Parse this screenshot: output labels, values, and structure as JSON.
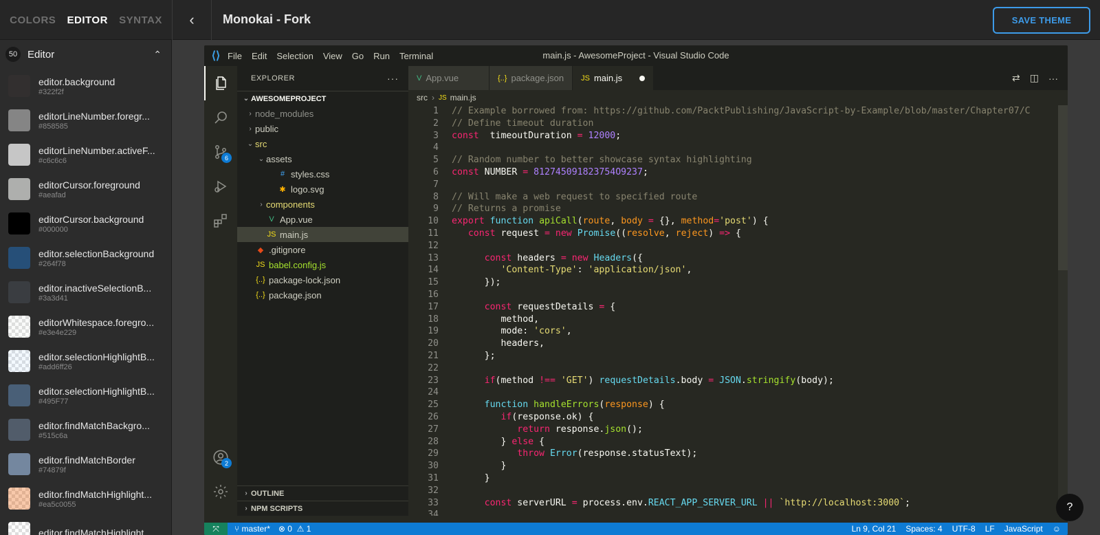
{
  "topbar": {
    "tabs": [
      "COLORS",
      "EDITOR",
      "SYNTAX"
    ],
    "active_tab": "EDITOR",
    "theme_name": "Monokai - Fork",
    "save_label": "SAVE THEME",
    "accent": "#3d9be9"
  },
  "palette": {
    "count": "50",
    "title": "Editor",
    "items": [
      {
        "name": "editor.background",
        "hex": "#322f2f",
        "color": "#322f2f"
      },
      {
        "name": "editorLineNumber.foregr...",
        "hex": "#858585",
        "color": "#858585"
      },
      {
        "name": "editorLineNumber.activeF...",
        "hex": "#c6c6c6",
        "color": "#c6c6c6"
      },
      {
        "name": "editorCursor.foreground",
        "hex": "#aeafad",
        "color": "#aeafad"
      },
      {
        "name": "editorCursor.background",
        "hex": "#000000",
        "color": "#000000"
      },
      {
        "name": "editor.selectionBackground",
        "hex": "#264f78",
        "color": "#264f78"
      },
      {
        "name": "editor.inactiveSelectionB...",
        "hex": "#3a3d41",
        "color": "#3a3d41"
      },
      {
        "name": "editorWhitespace.foregro...",
        "hex": "#e3e4e229",
        "color": "rgba(227,228,226,0.16)",
        "checker": true
      },
      {
        "name": "editor.selectionHighlightB...",
        "hex": "#add6ff26",
        "color": "rgba(173,214,255,0.15)",
        "checker": true
      },
      {
        "name": "editor.selectionHighlightB...",
        "hex": "#495F77",
        "color": "#495F77"
      },
      {
        "name": "editor.findMatchBackgro...",
        "hex": "#515c6a",
        "color": "#515c6a"
      },
      {
        "name": "editor.findMatchBorder",
        "hex": "#74879f",
        "color": "#74879f"
      },
      {
        "name": "editor.findMatchHighlight...",
        "hex": "#ea5c0055",
        "color": "rgba(234,92,0,0.33)",
        "checker": true
      },
      {
        "name": "editor.findMatchHighlight...",
        "hex": "",
        "color": "rgba(255,255,255,0.05)",
        "checker": true
      }
    ]
  },
  "vscode": {
    "menu": [
      "File",
      "Edit",
      "Selection",
      "View",
      "Go",
      "Run",
      "Terminal"
    ],
    "window_title": "main.js - AwesomeProject - Visual Studio Code",
    "activity_badges": {
      "scm": "6",
      "accounts": "2"
    },
    "explorer": {
      "header": "EXPLORER",
      "project": "AWESOMEPROJECT",
      "tree": [
        {
          "label": "node_modules",
          "depth": 1,
          "twisty": "›",
          "icon": "",
          "color": "#8f908a"
        },
        {
          "label": "public",
          "depth": 1,
          "twisty": "›",
          "icon": "",
          "color": "#cfcfc2"
        },
        {
          "label": "src",
          "depth": 1,
          "twisty": "⌄",
          "icon": "",
          "color": "#e6db74"
        },
        {
          "label": "assets",
          "depth": 2,
          "twisty": "⌄",
          "icon": "",
          "color": "#cfcfc2"
        },
        {
          "label": "styles.css",
          "depth": 3,
          "twisty": "",
          "icon": "#",
          "iconColor": "#42a5f5",
          "color": "#cfcfc2"
        },
        {
          "label": "logo.svg",
          "depth": 3,
          "twisty": "",
          "icon": "✱",
          "iconColor": "#ffb300",
          "color": "#cfcfc2"
        },
        {
          "label": "components",
          "depth": 2,
          "twisty": "›",
          "icon": "",
          "color": "#e6db74"
        },
        {
          "label": "App.vue",
          "depth": 2,
          "twisty": "",
          "icon": "V",
          "iconColor": "#41b883",
          "color": "#cfcfc2"
        },
        {
          "label": "main.js",
          "depth": 2,
          "twisty": "",
          "icon": "JS",
          "iconColor": "#f5de19",
          "color": "#cfcfc2",
          "selected": true
        },
        {
          "label": ".gitignore",
          "depth": 1,
          "twisty": "",
          "icon": "◆",
          "iconColor": "#e64a19",
          "color": "#cfcfc2"
        },
        {
          "label": "babel.config.js",
          "depth": 1,
          "twisty": "",
          "icon": "JS",
          "iconColor": "#f5de19",
          "color": "#a6e22e"
        },
        {
          "label": "package-lock.json",
          "depth": 1,
          "twisty": "",
          "icon": "{..}",
          "iconColor": "#f5de19",
          "color": "#cfcfc2"
        },
        {
          "label": "package.json",
          "depth": 1,
          "twisty": "",
          "icon": "{..}",
          "iconColor": "#f5de19",
          "color": "#cfcfc2"
        }
      ],
      "outline": "OUTLINE",
      "npm": "NPM SCRIPTS"
    },
    "tabs": [
      {
        "label": "App.vue",
        "icon": "V",
        "iconColor": "#41b883"
      },
      {
        "label": "package.json",
        "icon": "{..}",
        "iconColor": "#f5de19"
      },
      {
        "label": "main.js",
        "icon": "JS",
        "iconColor": "#f5de19",
        "active": true,
        "dirty": true
      }
    ],
    "breadcrumb": [
      "src",
      "main.js"
    ],
    "code": [
      [
        [
          "c-com",
          "// Example borrowed from: https://github.com/PacktPublishing/JavaScript-by-Example/blob/master/Chapter07/C"
        ]
      ],
      [
        [
          "c-com",
          "// Define timeout duration"
        ]
      ],
      [
        [
          "c-kw",
          "const"
        ],
        [
          "",
          "  timeoutDuration "
        ],
        [
          "c-kw",
          "="
        ],
        [
          "",
          " "
        ],
        [
          "c-num",
          "12000"
        ],
        [
          "",
          ";"
        ]
      ],
      [],
      [
        [
          "c-com",
          "// Random number to better showcase syntax highlighting"
        ]
      ],
      [
        [
          "c-kw",
          "const"
        ],
        [
          "",
          " NUMBER "
        ],
        [
          "c-kw",
          "="
        ],
        [
          "",
          " "
        ],
        [
          "c-num",
          "812745091823754O9237"
        ],
        [
          "",
          ";"
        ]
      ],
      [],
      [
        [
          "c-com",
          "// Will make a web request to specified route"
        ]
      ],
      [
        [
          "c-com",
          "// Returns a promise"
        ]
      ],
      [
        [
          "c-kw",
          "export"
        ],
        [
          "",
          " "
        ],
        [
          "c-ty",
          "function"
        ],
        [
          "",
          " "
        ],
        [
          "c-fn",
          "apiCall"
        ],
        [
          "",
          "("
        ],
        [
          "c-par",
          "route"
        ],
        [
          "",
          ", "
        ],
        [
          "c-par",
          "body"
        ],
        [
          "",
          " "
        ],
        [
          "c-kw",
          "="
        ],
        [
          "",
          " {}, "
        ],
        [
          "c-par",
          "method"
        ],
        [
          "c-kw",
          "="
        ],
        [
          "c-str",
          "'post'"
        ],
        [
          "",
          ") {"
        ]
      ],
      [
        [
          "",
          "   "
        ],
        [
          "c-kw",
          "const"
        ],
        [
          "",
          " request "
        ],
        [
          "c-kw",
          "="
        ],
        [
          "",
          " "
        ],
        [
          "c-kw",
          "new"
        ],
        [
          "",
          " "
        ],
        [
          "c-ty",
          "Promise"
        ],
        [
          "",
          "(("
        ],
        [
          "c-par",
          "resolve"
        ],
        [
          "",
          ", "
        ],
        [
          "c-par",
          "reject"
        ],
        [
          "",
          ") "
        ],
        [
          "c-kw",
          "=>"
        ],
        [
          "",
          " {"
        ]
      ],
      [],
      [
        [
          "",
          "      "
        ],
        [
          "c-kw",
          "const"
        ],
        [
          "",
          " headers "
        ],
        [
          "c-kw",
          "="
        ],
        [
          "",
          " "
        ],
        [
          "c-kw",
          "new"
        ],
        [
          "",
          " "
        ],
        [
          "c-ty",
          "Headers"
        ],
        [
          "",
          "({"
        ]
      ],
      [
        [
          "",
          "         "
        ],
        [
          "c-str",
          "'Content-Type'"
        ],
        [
          "",
          ": "
        ],
        [
          "c-str",
          "'application/json'"
        ],
        [
          "",
          ","
        ]
      ],
      [
        [
          "",
          "      });"
        ]
      ],
      [],
      [
        [
          "",
          "      "
        ],
        [
          "c-kw",
          "const"
        ],
        [
          "",
          " requestDetails "
        ],
        [
          "c-kw",
          "="
        ],
        [
          "",
          " {"
        ]
      ],
      [
        [
          "",
          "         method,"
        ]
      ],
      [
        [
          "",
          "         mode: "
        ],
        [
          "c-str",
          "'cors'"
        ],
        [
          "",
          ","
        ]
      ],
      [
        [
          "",
          "         headers,"
        ]
      ],
      [
        [
          "",
          "      };"
        ]
      ],
      [],
      [
        [
          "",
          "      "
        ],
        [
          "c-kw",
          "if"
        ],
        [
          "",
          "(method "
        ],
        [
          "c-kw",
          "!=="
        ],
        [
          "",
          " "
        ],
        [
          "c-str",
          "'GET'"
        ],
        [
          "",
          ") "
        ],
        [
          "c-ty",
          "requestDetails"
        ],
        [
          "",
          ".body "
        ],
        [
          "c-kw",
          "="
        ],
        [
          "",
          " "
        ],
        [
          "c-ty",
          "JSON"
        ],
        [
          "",
          "."
        ],
        [
          "c-fn",
          "stringify"
        ],
        [
          "",
          "(body);"
        ]
      ],
      [],
      [
        [
          "",
          "      "
        ],
        [
          "c-ty",
          "function"
        ],
        [
          "",
          " "
        ],
        [
          "c-fn",
          "handleErrors"
        ],
        [
          "",
          "("
        ],
        [
          "c-par",
          "response"
        ],
        [
          "",
          ") {"
        ]
      ],
      [
        [
          "",
          "         "
        ],
        [
          "c-kw",
          "if"
        ],
        [
          "",
          "(response.ok) {"
        ]
      ],
      [
        [
          "",
          "            "
        ],
        [
          "c-kw",
          "return"
        ],
        [
          "",
          " response."
        ],
        [
          "c-fn",
          "json"
        ],
        [
          "",
          "();"
        ]
      ],
      [
        [
          "",
          "         } "
        ],
        [
          "c-kw",
          "else"
        ],
        [
          "",
          " {"
        ]
      ],
      [
        [
          "",
          "            "
        ],
        [
          "c-kw",
          "throw"
        ],
        [
          "",
          " "
        ],
        [
          "c-ty",
          "Error"
        ],
        [
          "",
          "(response.statusText);"
        ]
      ],
      [
        [
          "",
          "         }"
        ]
      ],
      [
        [
          "",
          "      }"
        ]
      ],
      [],
      [
        [
          "",
          "      "
        ],
        [
          "c-kw",
          "const"
        ],
        [
          "",
          " serverURL "
        ],
        [
          "c-kw",
          "="
        ],
        [
          "",
          " process.env."
        ],
        [
          "c-ty",
          "REACT_APP_SERVER_URL"
        ],
        [
          "",
          " "
        ],
        [
          "c-kw",
          "||"
        ],
        [
          "",
          " "
        ],
        [
          "c-str",
          "`http://localhost:3000`"
        ],
        [
          "",
          ";"
        ]
      ],
      []
    ],
    "status": {
      "branch": "master*",
      "errors": "0",
      "warnings": "1",
      "position": "Ln 9, Col 21",
      "spaces": "Spaces: 4",
      "encoding": "UTF-8",
      "eol": "LF",
      "language": "JavaScript"
    }
  },
  "help": "?"
}
